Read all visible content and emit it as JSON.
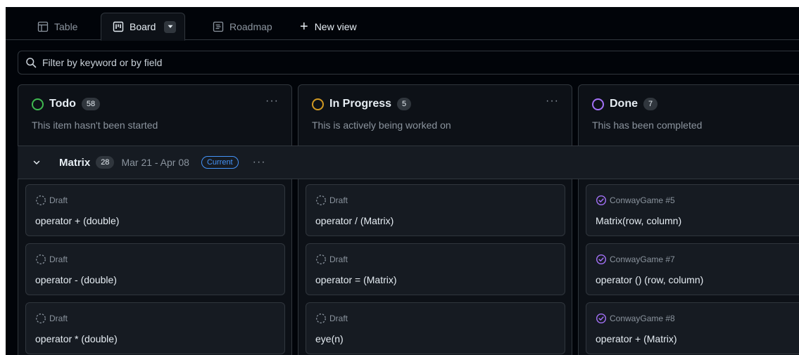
{
  "tabs": {
    "table": "Table",
    "board": "Board",
    "roadmap": "Roadmap",
    "new_view": "New view"
  },
  "filter": {
    "placeholder": "Filter by keyword or by field"
  },
  "columns": [
    {
      "name": "Todo",
      "count": "58",
      "description": "This item hasn't been started",
      "color": "#3fb950"
    },
    {
      "name": "In Progress",
      "count": "5",
      "description": "This is actively being worked on",
      "color": "#d29922"
    },
    {
      "name": "Done",
      "count": "7",
      "description": "This has been completed",
      "color": "#a371f7"
    }
  ],
  "group": {
    "name": "Matrix",
    "count": "28",
    "dates": "Mar 21 - Apr 08",
    "badge": "Current"
  },
  "cards": {
    "todo": [
      {
        "meta": "Draft",
        "title": "operator + (double)"
      },
      {
        "meta": "Draft",
        "title": "operator - (double)"
      },
      {
        "meta": "Draft",
        "title": "operator * (double)"
      }
    ],
    "in_progress": [
      {
        "meta": "Draft",
        "title": "operator / (Matrix)"
      },
      {
        "meta": "Draft",
        "title": "operator = (Matrix)"
      },
      {
        "meta": "Draft",
        "title": "eye(n)"
      }
    ],
    "done": [
      {
        "meta": "ConwayGame #5",
        "title": "Matrix(row, column)"
      },
      {
        "meta": "ConwayGame #7",
        "title": "operator () (row, column)"
      },
      {
        "meta": "ConwayGame #8",
        "title": "operator + (Matrix)"
      }
    ]
  },
  "colors": {
    "background": "#010409",
    "surface": "#0d1117",
    "card": "#161b22",
    "border": "#30363d",
    "accent_blue": "#4493f8",
    "closed_purple": "#a371f7"
  },
  "icons": {
    "table": "table-icon",
    "board": "board-icon",
    "roadmap": "roadmap-icon",
    "new_view": "plus-icon",
    "filter": "search-icon",
    "draft": "draft-issue-icon",
    "done": "issue-closed-icon"
  }
}
